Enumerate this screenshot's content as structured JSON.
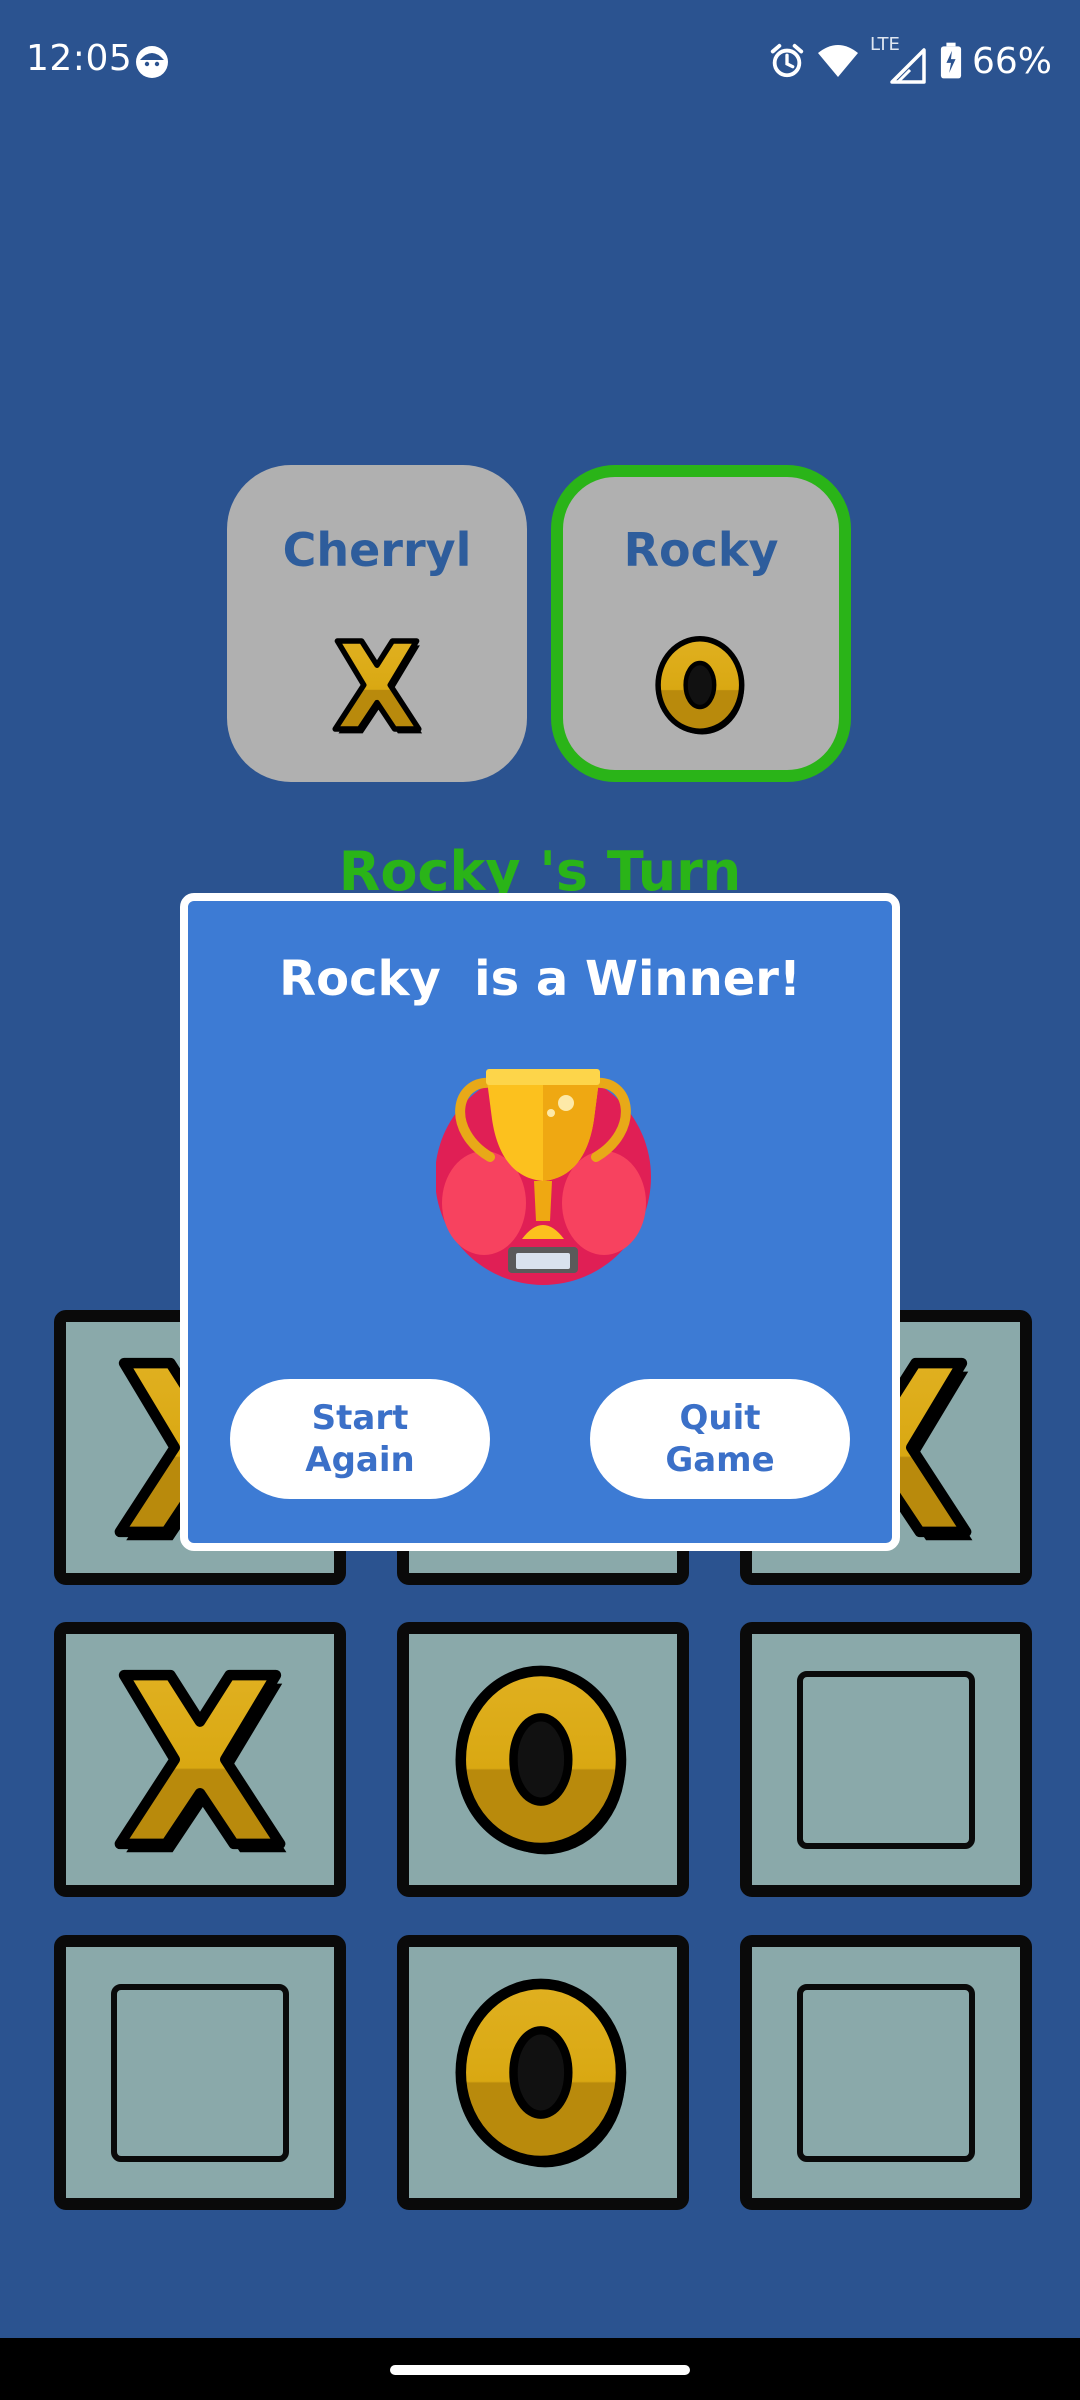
{
  "status_bar": {
    "time": "12:05",
    "battery": "66%",
    "network_label": "LTE",
    "icons": [
      "face-icon",
      "alarm-icon",
      "wifi-icon",
      "lte-signal-icon",
      "battery-icon"
    ]
  },
  "players": [
    {
      "name": "Cherryl",
      "symbol": "X",
      "active": false
    },
    {
      "name": "Rocky",
      "symbol": "O",
      "active": true
    }
  ],
  "turn_text": "Rocky 's Turn",
  "board": [
    [
      "X",
      "",
      "X"
    ],
    [
      "X",
      "O",
      ""
    ],
    [
      "",
      "O",
      ""
    ]
  ],
  "dialog": {
    "title": "Rocky  is a Winner!",
    "start_label": "Start\nAgain",
    "quit_label": "Quit\nGame"
  },
  "colors": {
    "background": "#2b5390",
    "active_border": "#2ab418",
    "dialog_bg": "#3d7bd4",
    "symbol_gold": "#c99a10",
    "cell_bg": "#8aa9aa"
  }
}
